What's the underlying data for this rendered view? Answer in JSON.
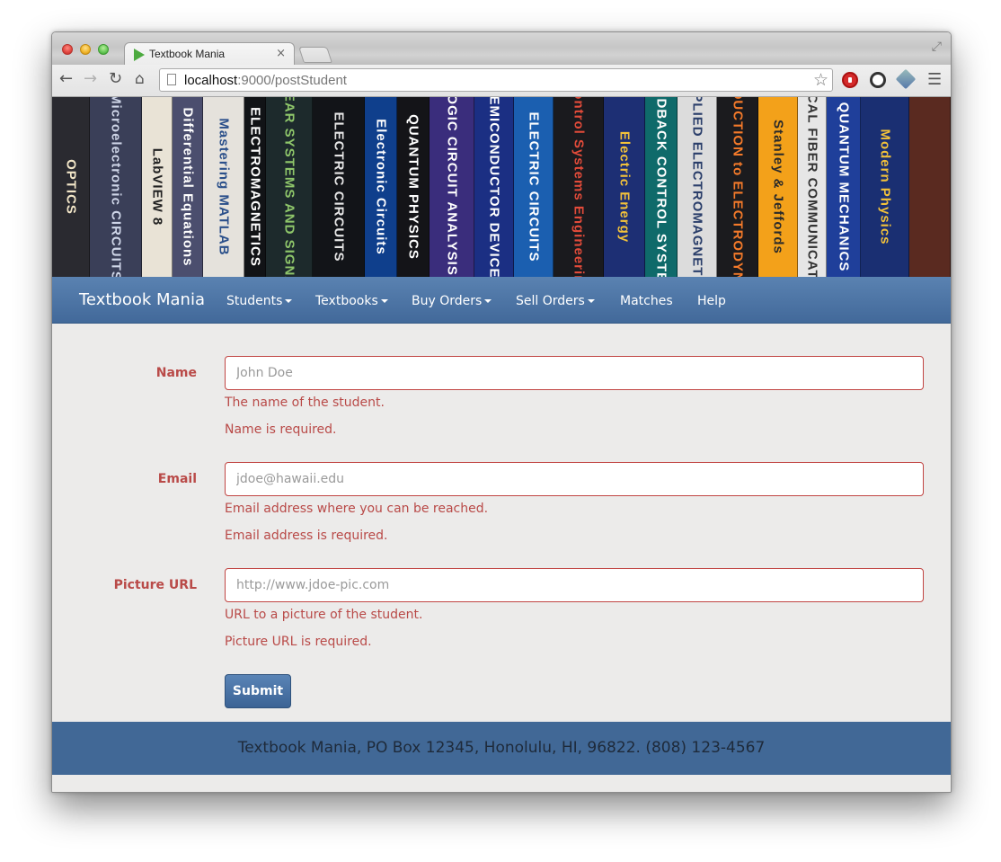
{
  "browser": {
    "tab_title": "Textbook Mania",
    "tab_close": "×",
    "url_host": "localhost",
    "url_rest": ":9000/postStudent"
  },
  "banner": {
    "books": [
      "OPTICS",
      "Microelectronic CIRCUITS",
      "LabVIEW 8",
      "Differential Equations",
      "Mastering MATLAB",
      "ELECTROMAGNETICS",
      "LINEAR SYSTEMS AND SIGNALS",
      "ELECTRIC CIRCUITS",
      "Electronic Circuits",
      "QUANTUM PHYSICS",
      "DIGITAL LOGIC CIRCUIT ANALYSIS & DESIGN",
      "SEMICONDUCTOR DEVICES",
      "ELECTRIC CIRCUITS",
      "Control Systems Engineering",
      "Electric Energy",
      "FEEDBACK CONTROL SYSTEMS",
      "APPLIED ELECTROMAGNETICS",
      "INTRODUCTION to ELECTRODYNAMICS",
      "Stanley & Jeffords",
      "OPTICAL FIBER COMMUNICATIONS",
      "QUANTUM MECHANICS",
      "Modern Physics"
    ]
  },
  "navbar": {
    "brand": "Textbook Mania",
    "items": [
      {
        "label": "Students",
        "dropdown": true
      },
      {
        "label": "Textbooks",
        "dropdown": true
      },
      {
        "label": "Buy Orders",
        "dropdown": true
      },
      {
        "label": "Sell Orders",
        "dropdown": true
      },
      {
        "label": "Matches",
        "dropdown": false
      },
      {
        "label": "Help",
        "dropdown": false
      }
    ]
  },
  "form": {
    "fields": [
      {
        "label": "Name",
        "placeholder": "John Doe",
        "help": "The name of the student.",
        "error": "Name is required."
      },
      {
        "label": "Email",
        "placeholder": "jdoe@hawaii.edu",
        "help": "Email address where you can be reached.",
        "error": "Email address is required."
      },
      {
        "label": "Picture URL",
        "placeholder": "http://www.jdoe-pic.com",
        "help": "URL to a picture of the student.",
        "error": "Picture URL is required."
      }
    ],
    "submit_label": "Submit",
    "error_color": "#b94a48"
  },
  "footer": {
    "text": "Textbook Mania, PO Box 12345, Honolulu, HI, 96822. (808) 123-4567"
  },
  "colors": {
    "navbar": "#4a72a3",
    "footer": "#416896",
    "page_bg": "#ecebea"
  }
}
